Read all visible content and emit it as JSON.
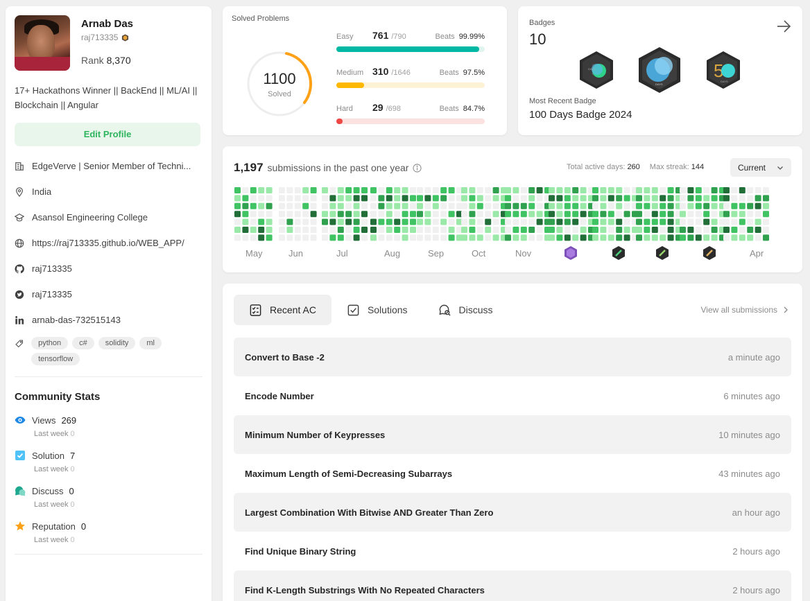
{
  "profile": {
    "name": "Arnab Das",
    "username": "raj713335",
    "rank_label": "Rank",
    "rank_value": "8,370",
    "bio": "17+ Hackathons Winner || BackEnd || ML/AI || Blockchain || Angular",
    "edit_button": "Edit Profile",
    "company": "EdgeVerve | Senior Member of Techni...",
    "location": "India",
    "school": "Asansol Engineering College",
    "website": "https://raj713335.github.io/WEB_APP/",
    "github": "raj713335",
    "twitter": "raj713335",
    "linkedin": "arnab-das-732515143",
    "skills": [
      "python",
      "c#",
      "solidity",
      "ml",
      "tensorflow"
    ]
  },
  "community": {
    "title": "Community Stats",
    "week_label": "Last week",
    "items": [
      {
        "label": "Views",
        "value": "269",
        "week": "0",
        "icon": "eye-icon",
        "color": "#1e88e5"
      },
      {
        "label": "Solution",
        "value": "7",
        "week": "0",
        "icon": "solution-check-icon",
        "color": "#4fc3f7"
      },
      {
        "label": "Discuss",
        "value": "0",
        "week": "0",
        "icon": "discuss-bubble-icon",
        "color": "#1fa890"
      },
      {
        "label": "Reputation",
        "value": "0",
        "week": "0",
        "icon": "star-icon",
        "color": "#ffa116"
      }
    ]
  },
  "solved": {
    "title": "Solved Problems",
    "total": "1100",
    "total_label": "Solved",
    "beats_label": "Beats",
    "difficulties": [
      {
        "name": "Easy",
        "solved": "761",
        "total": "/790",
        "beats": "99.99%",
        "fraction": 0.963,
        "color": "#00b8a3",
        "track": "#e0f4f0"
      },
      {
        "name": "Medium",
        "solved": "310",
        "total": "/1646",
        "beats": "97.5%",
        "fraction": 0.188,
        "color": "#ffb800",
        "track": "#fdf1d6"
      },
      {
        "name": "Hard",
        "solved": "29",
        "total": "/698",
        "beats": "84.7%",
        "fraction": 0.042,
        "color": "#ef4743",
        "track": "#fbe1e0"
      }
    ]
  },
  "badges": {
    "title": "Badges",
    "count": "10",
    "recent_label": "Most Recent Badge",
    "recent_name": "100 Days Badge 2024"
  },
  "calendar": {
    "count": "1,197",
    "text": "submissions in the past one year",
    "active_label": "Total active days:",
    "active_value": "260",
    "streak_label": "Max streak:",
    "streak_value": "144",
    "select_value": "Current",
    "months": [
      "May",
      "Jun",
      "Jul",
      "Aug",
      "Sep",
      "Oct",
      "Nov",
      "Apr"
    ],
    "colors": {
      "empty": "#f0f0f0",
      "l1": "#9be9a8",
      "l2": "#40c463",
      "l3": "#30a14e",
      "l4": "#216e39"
    }
  },
  "recent": {
    "tabs": [
      "Recent AC",
      "Solutions",
      "Discuss"
    ],
    "view_all": "View all submissions",
    "items": [
      {
        "title": "Convert to Base -2",
        "time": "a minute ago"
      },
      {
        "title": "Encode Number",
        "time": "6 minutes ago"
      },
      {
        "title": "Minimum Number of Keypresses",
        "time": "10 minutes ago"
      },
      {
        "title": "Maximum Length of Semi-Decreasing Subarrays",
        "time": "43 minutes ago"
      },
      {
        "title": "Largest Combination With Bitwise AND Greater Than Zero",
        "time": "an hour ago"
      },
      {
        "title": "Find Unique Binary String",
        "time": "2 hours ago"
      },
      {
        "title": "Find K-Length Substrings With No Repeated Characters",
        "time": "2 hours ago"
      }
    ]
  }
}
